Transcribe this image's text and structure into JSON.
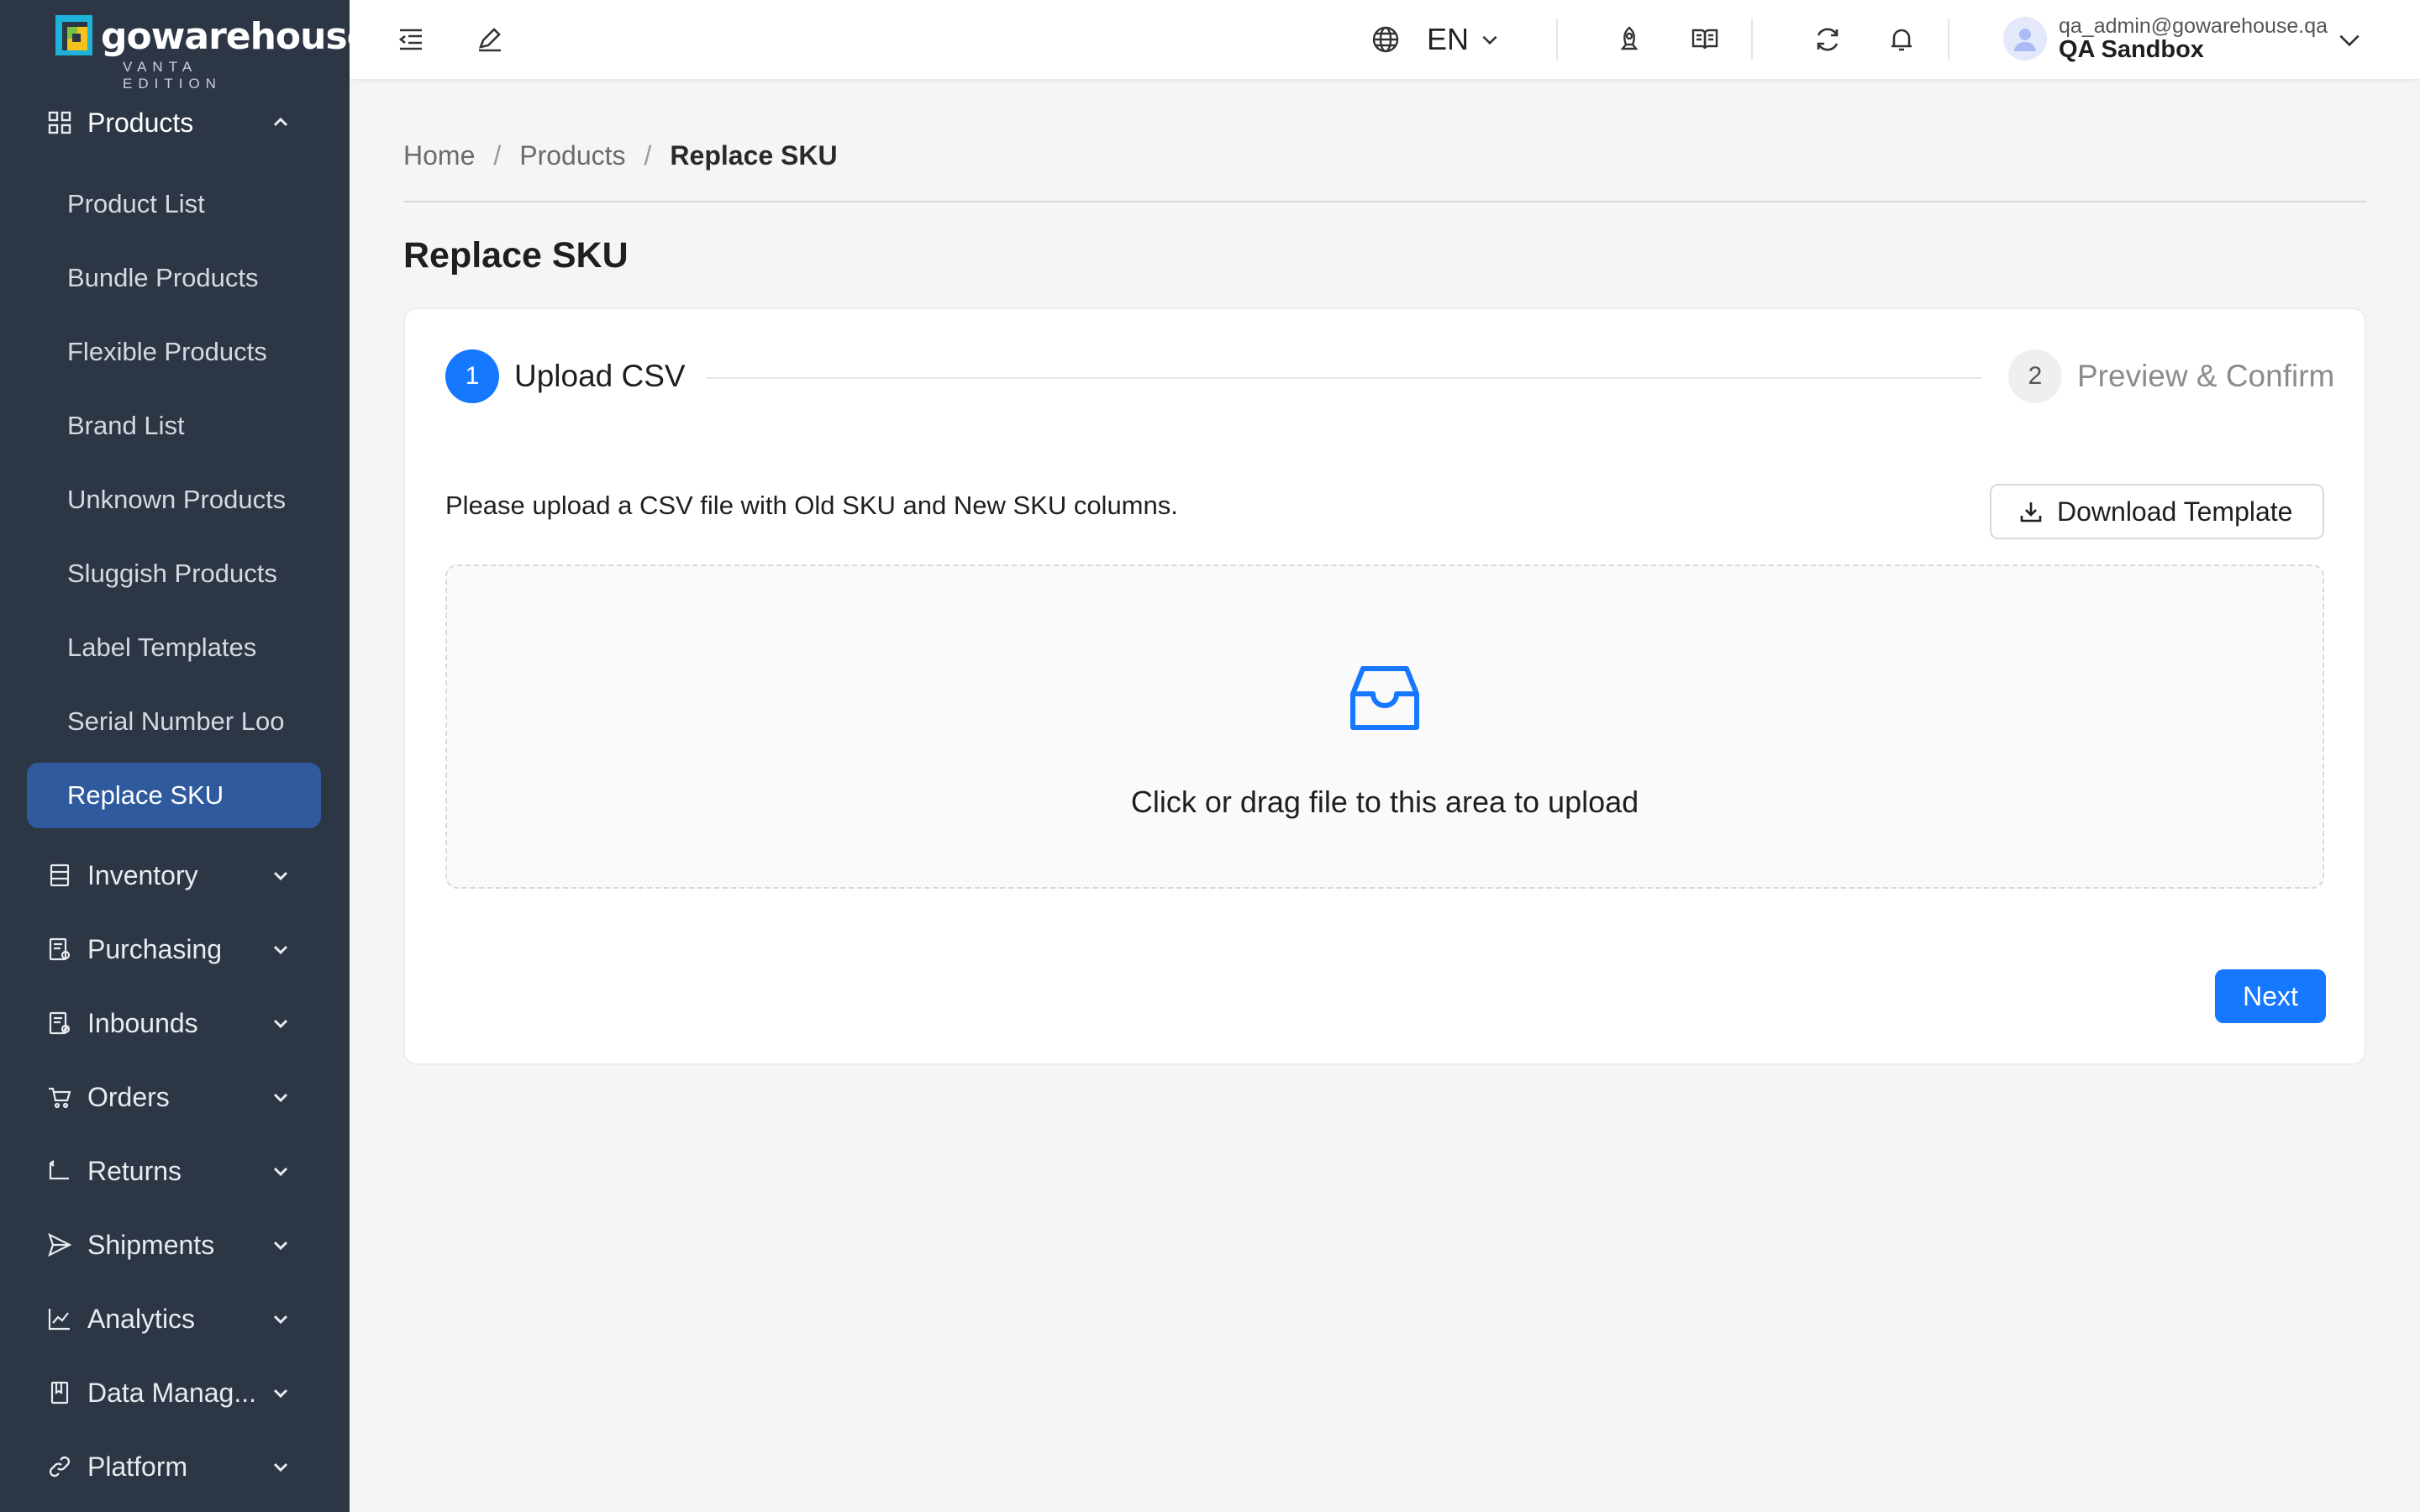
{
  "brand": {
    "name": "gowarehouse",
    "edition": "VANTA EDITION",
    "accent": "#1677ff",
    "sidebar_bg": "#2d3645",
    "active_bg": "#2f5b9e"
  },
  "sidebar": {
    "products_group": {
      "label": "Products",
      "icon": "grid-icon",
      "expanded": true
    },
    "product_items": [
      {
        "label": "Product List"
      },
      {
        "label": "Bundle Products"
      },
      {
        "label": "Flexible Products"
      },
      {
        "label": "Brand List"
      },
      {
        "label": "Unknown Products"
      },
      {
        "label": "Sluggish Products"
      },
      {
        "label": "Label Templates"
      },
      {
        "label": "Serial Number Loo"
      },
      {
        "label": "Replace SKU",
        "active": true
      }
    ],
    "groups": [
      {
        "label": "Inventory",
        "icon": "inventory-icon"
      },
      {
        "label": "Purchasing",
        "icon": "purchasing-icon"
      },
      {
        "label": "Inbounds",
        "icon": "inbounds-icon"
      },
      {
        "label": "Orders",
        "icon": "cart-icon"
      },
      {
        "label": "Returns",
        "icon": "return-icon"
      },
      {
        "label": "Shipments",
        "icon": "send-icon"
      },
      {
        "label": "Analytics",
        "icon": "line-chart-icon"
      },
      {
        "label": "Data Manag...",
        "icon": "book-icon"
      },
      {
        "label": "Platform",
        "icon": "link-icon"
      }
    ]
  },
  "header": {
    "language": "EN",
    "user_email": "qa_admin@gowarehouse.qa",
    "user_org": "QA Sandbox"
  },
  "breadcrumb": [
    "Home",
    "Products",
    "Replace SKU"
  ],
  "page": {
    "title": "Replace SKU",
    "steps": [
      {
        "number": "1",
        "label": "Upload CSV",
        "status": "current"
      },
      {
        "number": "2",
        "label": "Preview & Confirm",
        "status": "wait"
      }
    ],
    "instructions": "Please upload a CSV file with Old SKU and New SKU columns.",
    "download_label": "Download Template",
    "dropzone_text": "Click or drag file to this area to upload",
    "next_label": "Next"
  }
}
